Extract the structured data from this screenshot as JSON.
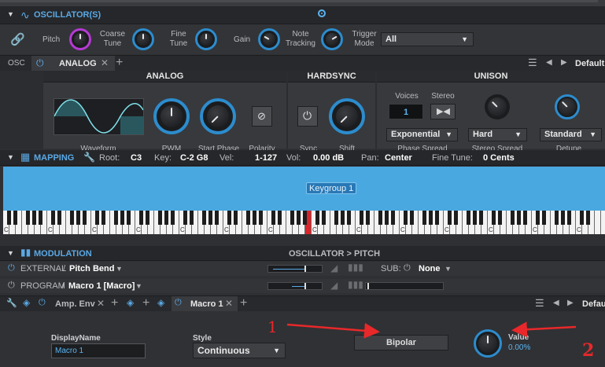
{
  "oscillators": {
    "title": "OSCILLATOR(S)",
    "pitch_label": "Pitch",
    "coarse_label": "Coarse\nTune",
    "fine_label": "Fine\nTune",
    "gain_label": "Gain",
    "note_tracking_label": "Note\nTracking",
    "trigger_mode_label": "Trigger\nMode",
    "trigger_mode_value": "All"
  },
  "osc_tabs": {
    "osc_label": "OSC",
    "tab_label": "ANALOG",
    "preset_label": "Default"
  },
  "analog": {
    "header": "ANALOG",
    "waveform_label": "Waveform",
    "pwm_label": "PWM",
    "start_phase_label": "Start Phase",
    "polarity_label": "Polarity"
  },
  "hardsync": {
    "header": "HARDSYNC",
    "sync_label": "Sync",
    "shift_label": "Shift"
  },
  "unison": {
    "header": "UNISON",
    "voices_label": "Voices",
    "voices_value": "1",
    "stereo_label": "Stereo",
    "phase_spread_value": "Exponential",
    "phase_spread_label": "Phase Spread",
    "stereo_spread_value": "Hard",
    "stereo_spread_label": "Stereo Spread",
    "detune_value": "Standard",
    "detune_label": "Detune"
  },
  "mapping": {
    "title": "MAPPING",
    "root_label": "Root:",
    "root_value": "C3",
    "key_label": "Key:",
    "key_value": "C-2 G8",
    "vel_label": "Vel:",
    "vel_value": "1-127",
    "vol_label": "Vol:",
    "vol_value": "0.00 dB",
    "pan_label": "Pan:",
    "pan_value": "Center",
    "finetune_label": "Fine Tune:",
    "finetune_value": "0 Cents",
    "keygroup_label": "Keygroup 1",
    "c_marker": "C"
  },
  "modulation": {
    "title": "MODULATION",
    "path": "OSCILLATOR > PITCH",
    "external_label": "EXTERNAL",
    "external_value": "Pitch Bend",
    "sub_label": "SUB:",
    "sub_value": "None",
    "program_label": "PROGRAM",
    "program_value": "Macro 1 [Macro]",
    "tab_ampenv": "Amp. Env",
    "tab_macro": "Macro 1",
    "preset_label": "Defau",
    "sep": "/"
  },
  "macro": {
    "displayname_label": "DisplayName",
    "displayname_value": "Macro 1",
    "style_label": "Style",
    "style_value": "Continuous",
    "bipolar_label": "Bipolar",
    "value_label": "Value",
    "value_value": "0.00%"
  },
  "annotations": {
    "label_1": "1",
    "label_2": "2",
    "color": "#e8282a"
  }
}
